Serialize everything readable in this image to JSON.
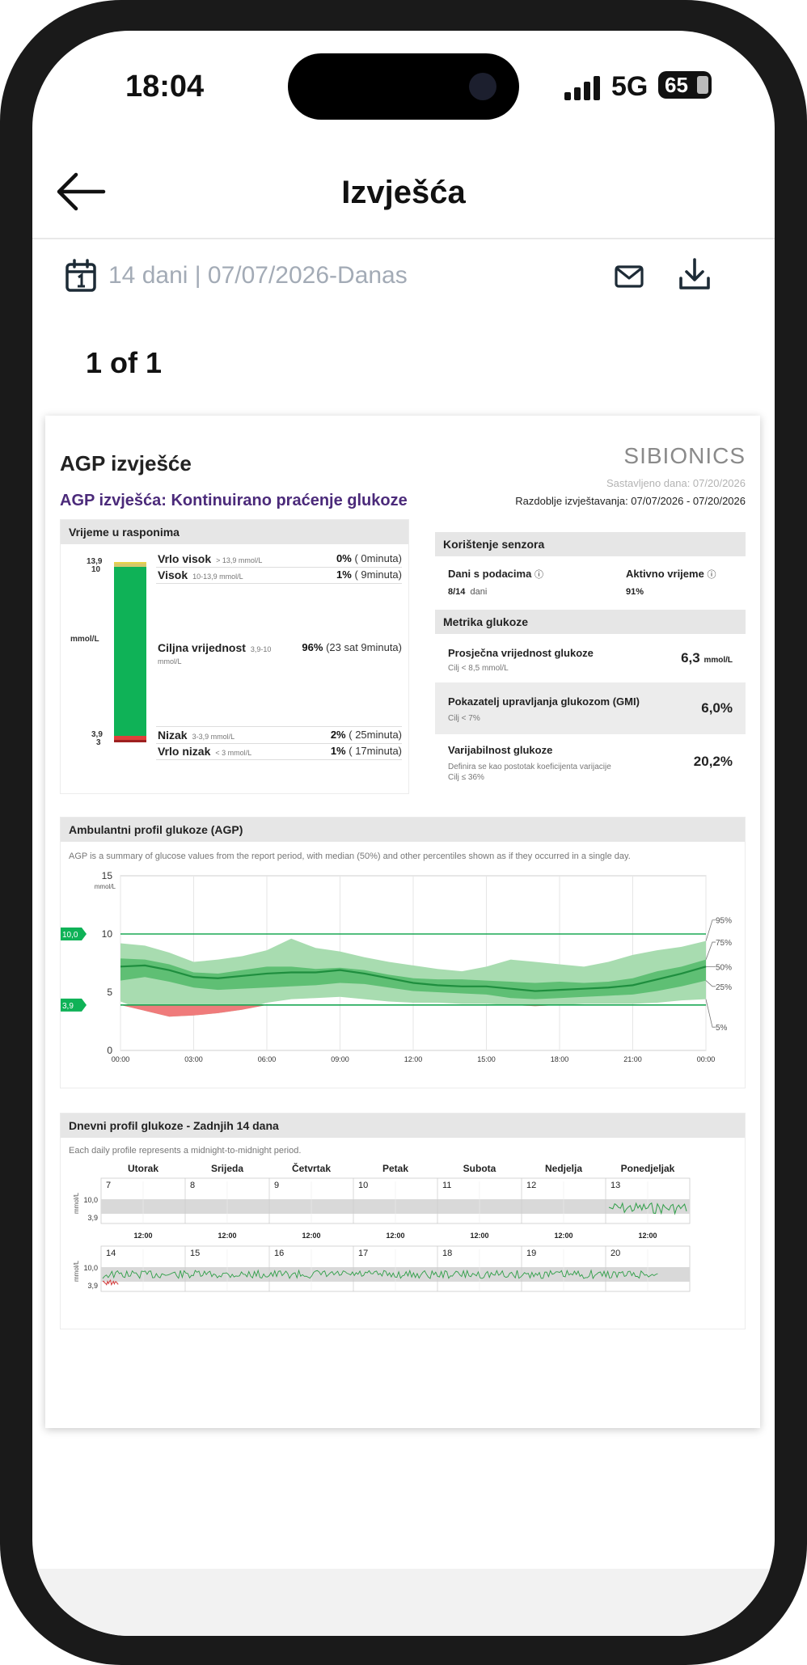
{
  "status_bar": {
    "time": "18:04",
    "network": "5G",
    "battery": "65"
  },
  "nav": {
    "title": "Izvješća"
  },
  "toolbar": {
    "range": "14 dani | 07/07/2026-Danas"
  },
  "pager": {
    "text": "1 of 1"
  },
  "report": {
    "title": "AGP izvješće",
    "brand": "SIBIONICS",
    "subtitle": "AGP izvješća: Kontinuirano praćenje glukoze",
    "compiled": "Sastavljeno dana: 07/20/2026",
    "period": "Razdoblje izvještavanja: 07/07/2026 - 07/20/2026",
    "time_in_range": {
      "header": "Vrijeme u rasponima",
      "unit": "mmol/L",
      "axis_ticks": [
        "13,9",
        "10",
        "3,9",
        "3"
      ],
      "rows": [
        {
          "label": "Vrlo visok",
          "range": "> 13,9 mmol/L",
          "pct": "0%",
          "time": "( 0minuta)",
          "color": "#e8d24a",
          "value": 0
        },
        {
          "label": "Visok",
          "range": "10-13,9 mmol/L",
          "pct": "1%",
          "time": "( 9minuta)",
          "color": "#d6c86a",
          "value": 1
        },
        {
          "label": "Ciljna vrijednost",
          "range": "3,9-10",
          "unit": "mmol/L",
          "pct": "96%",
          "time": "(23 sat 9minuta)",
          "color": "#0fb257",
          "value": 96
        },
        {
          "label": "Nizak",
          "range": "3-3,9 mmol/L",
          "pct": "2%",
          "time": "( 25minuta)",
          "color": "#e0403a",
          "value": 2
        },
        {
          "label": "Vrlo nizak",
          "range": "< 3 mmol/L",
          "pct": "1%",
          "time": "( 17minuta)",
          "color": "#9e1f1f",
          "value": 1
        }
      ]
    },
    "sensor": {
      "header": "Korištenje senzora",
      "days_label": "Dani s podacima",
      "days_value": "8/14",
      "days_unit": "dani",
      "active_label": "Aktivno vrijeme",
      "active_value": "91%"
    },
    "glucose_metrics": {
      "header": "Metrika glukoze",
      "items": [
        {
          "name": "Prosječna vrijednost glukoze",
          "sub": "Cilj < 8,5 mmol/L",
          "value": "6,3",
          "unit": "mmol/L"
        },
        {
          "name": "Pokazatelj upravljanja glukozom (GMI)",
          "sub": "Cilj < 7%",
          "value": "6,0%",
          "unit": ""
        },
        {
          "name": "Varijabilnost glukoze",
          "sub": "Definira se kao postotak koeficijenta varijacije",
          "sub2": "Cilj ≤ 36%",
          "value": "20,2%",
          "unit": ""
        }
      ]
    },
    "agp": {
      "header": "Ambulantni profil glukoze (AGP)",
      "note": "AGP is a summary of glucose values from the report period, with median (50%) and other percentiles shown as if they occurred in a single day.",
      "target_high": "10,0",
      "target_low": "3,9",
      "percentile_labels": [
        "95%",
        "75%",
        "50%",
        "25%",
        "5%"
      ]
    },
    "daily": {
      "header": "Dnevni profil glukoze - Zadnjih 14 dana",
      "note": "Each daily profile represents a midnight-to-midnight period.",
      "weekdays": [
        "Utorak",
        "Srijeda",
        "Četvrtak",
        "Petak",
        "Subota",
        "Nedjelja",
        "Ponedjeljak"
      ],
      "week1_days": [
        "7",
        "8",
        "9",
        "10",
        "11",
        "12",
        "13"
      ],
      "week2_days": [
        "14",
        "15",
        "16",
        "17",
        "18",
        "19",
        "20"
      ],
      "noon_label": "12:00",
      "y_labels": [
        "10,0",
        "3,9"
      ],
      "unit": "mmol/L"
    }
  },
  "chart_data": [
    {
      "type": "area",
      "title": "Ambulantni profil glukoze (AGP)",
      "xlabel": "",
      "ylabel": "mmol/L",
      "x_ticks": [
        "00:00",
        "03:00",
        "06:00",
        "09:00",
        "12:00",
        "15:00",
        "18:00",
        "21:00",
        "00:00"
      ],
      "y_ticks": [
        0,
        5,
        10,
        15
      ],
      "ylim": [
        0,
        15
      ],
      "x_hours": [
        0,
        1,
        2,
        3,
        4,
        5,
        6,
        7,
        8,
        9,
        10,
        11,
        12,
        13,
        14,
        15,
        16,
        17,
        18,
        19,
        20,
        21,
        22,
        23,
        24
      ],
      "series": [
        {
          "name": "95%",
          "values": [
            9.2,
            9.0,
            8.4,
            7.6,
            7.8,
            8.1,
            8.6,
            9.6,
            8.8,
            8.5,
            8.0,
            7.6,
            7.3,
            7.0,
            6.8,
            7.2,
            7.8,
            7.6,
            7.4,
            7.2,
            7.6,
            8.2,
            8.6,
            8.9,
            9.4
          ]
        },
        {
          "name": "75%",
          "values": [
            7.9,
            7.8,
            7.4,
            6.7,
            6.6,
            6.9,
            7.2,
            7.2,
            7.0,
            7.1,
            6.9,
            6.5,
            6.2,
            6.1,
            6.1,
            6.0,
            5.9,
            5.8,
            5.9,
            5.8,
            5.9,
            6.2,
            6.8,
            7.2,
            7.8
          ]
        },
        {
          "name": "50%",
          "values": [
            7.2,
            7.3,
            6.9,
            6.3,
            6.2,
            6.4,
            6.6,
            6.7,
            6.7,
            6.9,
            6.6,
            6.2,
            5.8,
            5.6,
            5.5,
            5.5,
            5.3,
            5.1,
            5.2,
            5.3,
            5.4,
            5.6,
            6.1,
            6.6,
            7.2
          ]
        },
        {
          "name": "25%",
          "values": [
            6.0,
            6.3,
            5.9,
            5.4,
            5.2,
            5.3,
            5.4,
            5.5,
            5.6,
            5.8,
            5.7,
            5.4,
            5.1,
            5.0,
            4.9,
            4.8,
            4.5,
            4.4,
            4.5,
            4.6,
            4.7,
            4.8,
            5.1,
            5.5,
            6.0
          ]
        },
        {
          "name": "5%",
          "values": [
            4.2,
            3.4,
            2.9,
            3.0,
            3.2,
            3.5,
            4.1,
            4.4,
            4.5,
            4.6,
            4.4,
            4.2,
            4.1,
            4.1,
            4.0,
            4.0,
            3.9,
            3.8,
            3.9,
            4.0,
            4.0,
            4.0,
            4.1,
            4.3,
            4.4
          ]
        }
      ],
      "target_range": [
        3.9,
        10.0
      ]
    }
  ]
}
